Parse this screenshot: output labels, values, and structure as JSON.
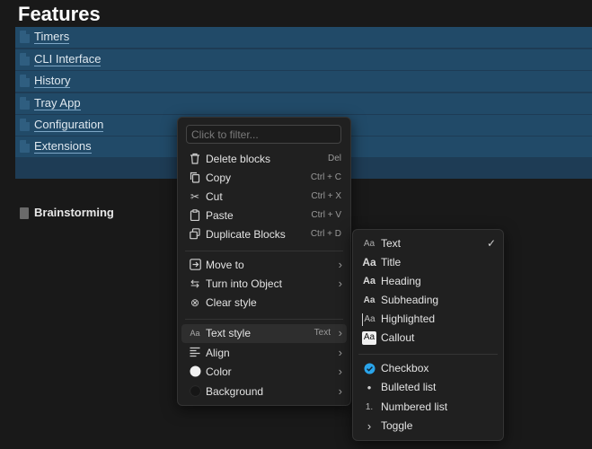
{
  "page": {
    "title": "Features"
  },
  "blocks": [
    {
      "label": "Timers"
    },
    {
      "label": "CLI Interface"
    },
    {
      "label": "History"
    },
    {
      "label": "Tray App"
    },
    {
      "label": "Configuration"
    },
    {
      "label": "Extensions"
    }
  ],
  "brainstorming": {
    "label": "Brainstorming"
  },
  "context_menu": {
    "filter_placeholder": "Click to filter...",
    "items": [
      {
        "label": "Delete blocks",
        "shortcut": "Del",
        "icon": "trash-icon"
      },
      {
        "label": "Copy",
        "shortcut": "Ctrl + C",
        "icon": "copy-icon"
      },
      {
        "label": "Cut",
        "shortcut": "Ctrl + X",
        "icon": "scissors-icon"
      },
      {
        "label": "Paste",
        "shortcut": "Ctrl + V",
        "icon": "clipboard-icon"
      },
      {
        "label": "Duplicate Blocks",
        "shortcut": "Ctrl + D",
        "icon": "duplicate-icon"
      },
      {
        "label": "Move to",
        "icon": "move-icon"
      },
      {
        "label": "Turn into Object",
        "icon": "swap-icon"
      },
      {
        "label": "Clear style",
        "icon": "clear-icon"
      },
      {
        "label": "Text style",
        "value": "Text",
        "icon": "text-style-icon"
      },
      {
        "label": "Align",
        "icon": "align-icon"
      },
      {
        "label": "Color",
        "icon": "color-dot-icon"
      },
      {
        "label": "Background",
        "icon": "background-dot-icon"
      }
    ]
  },
  "text_style_menu": {
    "items": [
      {
        "label": "Text",
        "selected": true,
        "icon_text": "Aa"
      },
      {
        "label": "Title",
        "icon_text": "Aa"
      },
      {
        "label": "Heading",
        "icon_text": "Aa"
      },
      {
        "label": "Subheading",
        "icon_text": "Aa"
      },
      {
        "label": "Highlighted",
        "icon_text": "Aa"
      },
      {
        "label": "Callout",
        "icon_text": "Aa"
      },
      {
        "label": "Checkbox",
        "icon": "checkbox-icon"
      },
      {
        "label": "Bulleted list",
        "icon": "bullet-icon"
      },
      {
        "label": "Numbered list",
        "icon_text": "1."
      },
      {
        "label": "Toggle",
        "icon": "toggle-chevron-icon"
      }
    ]
  },
  "colors": {
    "background": "#191919",
    "selection": "#1e3c55",
    "menu_bg": "#202020",
    "checkbox_accent": "#2aa4ea"
  }
}
